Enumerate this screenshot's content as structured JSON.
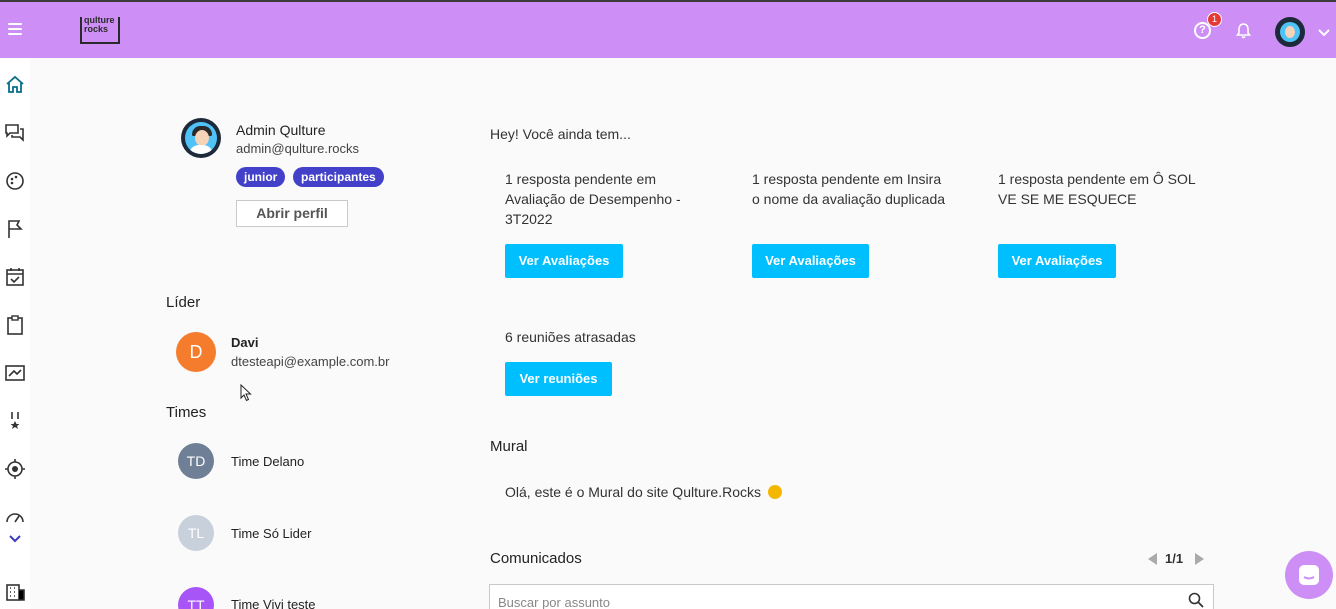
{
  "brand": {
    "logo_text": "qulture\nrocks"
  },
  "header": {
    "help_badge_count": "1",
    "help_glyph": "?"
  },
  "profile": {
    "name": "Admin Qulture",
    "email": "admin@qulture.rocks",
    "tags": [
      "junior",
      "participantes"
    ],
    "open_profile_label": "Abrir perfil"
  },
  "leader": {
    "title": "Líder",
    "initial": "D",
    "name": "Davi",
    "email": "dtesteapi@example.com.br",
    "color": "#f47c2c"
  },
  "teams": {
    "title": "Times",
    "items": [
      {
        "initials": "TD",
        "name": "Time Delano",
        "color": "#6f7f95"
      },
      {
        "initials": "TL",
        "name": "Time Só Lider",
        "color": "#c8d0dc"
      },
      {
        "initials": "TT",
        "name": "Time Vivi teste",
        "color": "#a855f7"
      }
    ]
  },
  "pending": {
    "title": "Hey! Você ainda tem...",
    "items": [
      {
        "text": "1 resposta pendente em Avaliação de Desempenho - 3T2022",
        "button": "Ver Avaliações"
      },
      {
        "text": "1 resposta pendente em Insira o nome da avaliação duplicada",
        "button": "Ver Avaliações"
      },
      {
        "text": "1 resposta pendente em Ô SOL VE SE ME ESQUECE",
        "button": "Ver Avaliações"
      }
    ],
    "meetings": {
      "text": "6 reuniões atrasadas",
      "button": "Ver reuniões"
    }
  },
  "mural": {
    "title": "Mural",
    "text": "Olá, este é o Mural do site Qulture.Rocks"
  },
  "announcements": {
    "title": "Comunicados",
    "pager": "1/1",
    "search_placeholder": "Buscar por assunto"
  },
  "colors": {
    "topbar": "#cd8ff5",
    "primary_button": "#00bfff",
    "tag": "#4341c9"
  }
}
